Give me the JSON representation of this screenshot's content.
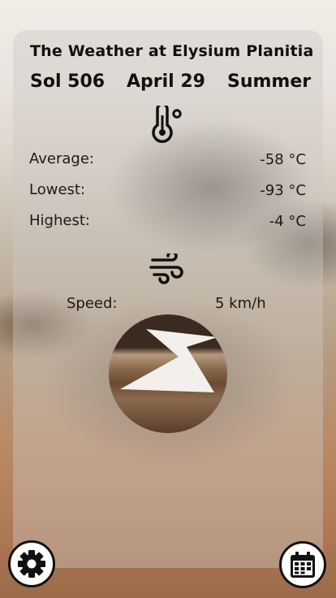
{
  "header": {
    "title": "The Weather at Elysium Planitia",
    "sol": "Sol 506",
    "date": "April 29",
    "season": "Summer"
  },
  "temperature": {
    "icon": "thermometer-icon",
    "average_label": "Average:",
    "average_value": "-58 °C",
    "lowest_label": "Lowest:",
    "lowest_value": "-93 °C",
    "highest_label": "Highest:",
    "highest_value": "-4 °C"
  },
  "wind": {
    "icon": "wind-icon",
    "speed_label": "Speed:",
    "speed_value": "5 km/h",
    "direction_icon": "wind-direction-arrow-icon"
  },
  "actions": {
    "settings_icon": "gear-icon",
    "calendar_icon": "calendar-icon"
  }
}
